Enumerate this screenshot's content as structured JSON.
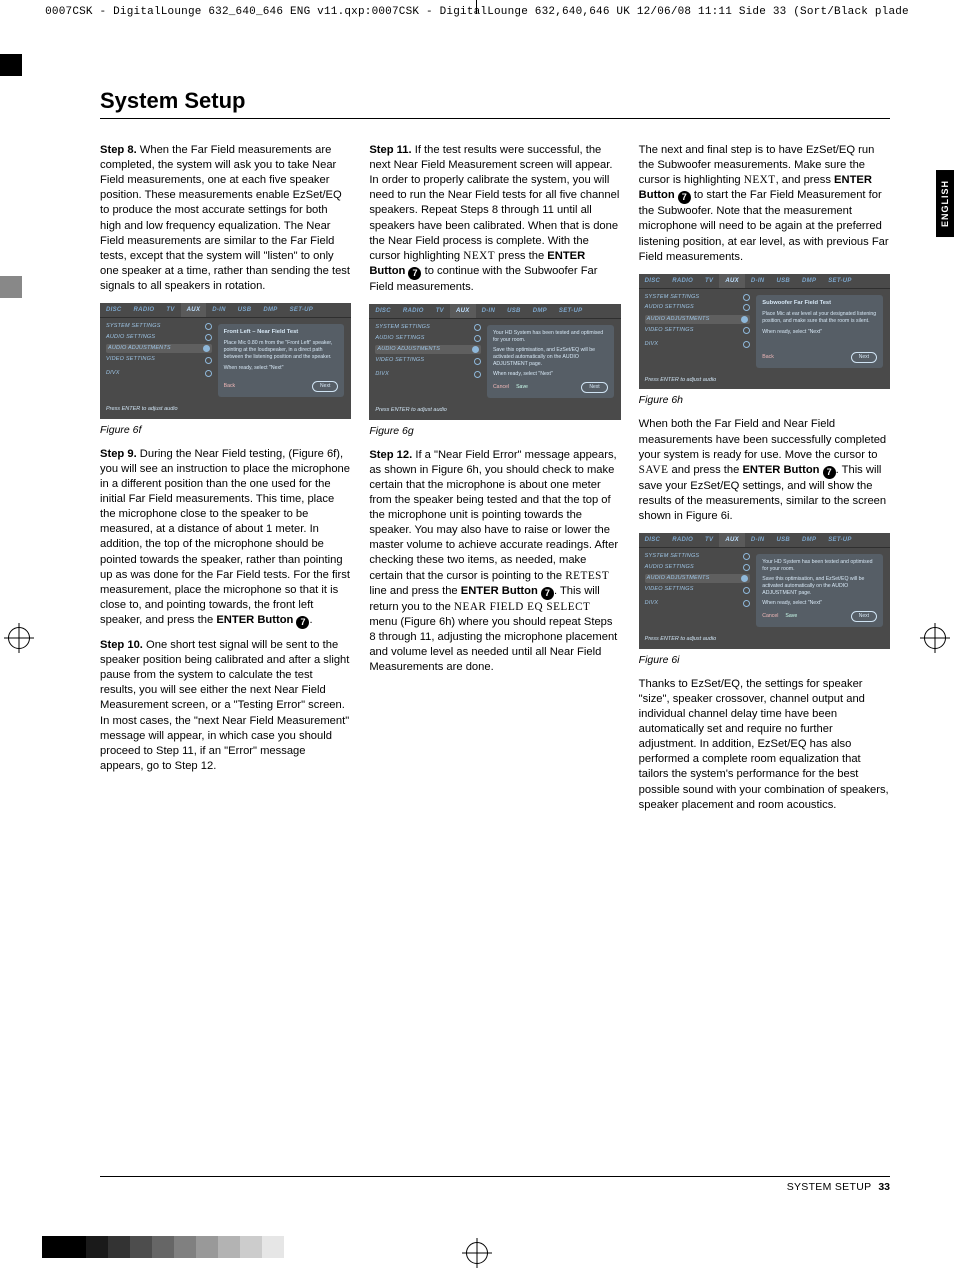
{
  "print_header": "0007CSK - DigitalLounge 632_640_646 ENG v11.qxp:0007CSK - DigitalLounge 632,640,646 UK  12/06/08  11:11  Side 33   (Sort/Black plade",
  "title": "System Setup",
  "side_tab": "ENGLISH",
  "footer": {
    "section": "SYSTEM SETUP",
    "page": "33"
  },
  "col1": {
    "p1a": "Step 8.",
    "p1b": " When the Far Field measurements are completed, the system will ask you to take Near Field measurements, one at each five speaker position. These measurements enable EzSet/EQ to produce the most accurate settings for both high and low frequency equalization. The Near Field measurements are similar to the Far Field tests, except that the system will \"listen\" to only one speaker at a time, rather than sending the test signals to all speakers in rotation.",
    "fig6f": "Figure 6f",
    "p2a": "Step 9.",
    "p2b": " During the Near Field testing, (Figure 6f), you will see an instruction to place the microphone in a different position than the one used for the initial Far Field measurements. This time, place the microphone close to the speaker to be measured, at a distance of about 1 meter. In addition, the top of the microphone should be pointed towards the speaker, rather than pointing up as was done for the Far Field tests. For the first measurement, place the microphone so that it is close to, and pointing towards, the front left speaker, and press the ",
    "p2c": "ENTER Button",
    "p2d": ".",
    "p3a": "Step 10.",
    "p3b": " One short test signal will be sent to the speaker position being calibrated and after a slight pause from the system to calculate the test results, you will see either the next Near Field Measurement screen, or a \"Testing Error\" screen. In most cases, the \"next Near Field Measurement\" message will appear, in which case you should proceed to Step 11, if an \"Error\" message appears, go to Step 12."
  },
  "col2": {
    "p1a": "Step 11.",
    "p1b": " If the test results were successful, the next Near Field Measurement screen will appear. In order to properly calibrate the system, you will need to run the Near Field tests for all five channel speakers. Repeat Steps 8 through 11 until all speakers have been calibrated. When that is done the Near Field process is complete. With the cursor highlighting ",
    "p1c": "NEXT",
    "p1d": " press the ",
    "p1e": "ENTER Button",
    "p1f": " to continue with the Subwoofer Far Field measurements.",
    "fig6g": "Figure 6g",
    "p2a": "Step 12.",
    "p2b": " If a \"Near Field Error\" message appears, as shown in Figure 6h, you should check to make certain that the microphone is about one meter from the speaker being tested and that the top of the microphone unit is pointing towards the speaker. You may also have to raise or lower the master volume to achieve accurate readings. After checking these two items, as needed, make certain that the cursor is pointing to the ",
    "p2c": "RETEST",
    "p2d": " line and press the ",
    "p2e": "ENTER Button",
    "p2f": ". This will return you to the ",
    "p2g": "NEAR FIELD EQ SELECT",
    "p2h": " menu (Figure 6h) where you should repeat Steps 8 through 11, adjusting the microphone placement and volume level as needed until all Near Field Measurements are done."
  },
  "col3": {
    "p1a": "The next and final step is to have EzSet/EQ run the Subwoofer measurements. Make sure the cursor is highlighting ",
    "p1b": "NEXT",
    "p1c": ", and press ",
    "p1d": "ENTER Button",
    "p1e": " to start the Far Field Measurement for the Subwoofer. Note that the measurement microphone will need to be again at the preferred listening position, at ear level, as with previous Far Field measurements.",
    "fig6h": "Figure 6h",
    "p2a": "When both the Far Field and Near Field measurements have been successfully completed your system is ready for use. Move the cursor to ",
    "p2b": "SAVE",
    "p2c": " and press the ",
    "p2d": "ENTER Button",
    "p2e": ". This will save your EzSet/EQ settings, and will show the results of the measurements, similar to the screen shown in Figure 6i.",
    "fig6i": "Figure 6i",
    "p3": "Thanks to EzSet/EQ, the settings for speaker \"size\", speaker crossover, channel output and individual channel delay time have been automatically set and require no further adjustment. In addition, EzSet/EQ has also performed a complete room equalization that tailors the system's performance for the best possible sound with your combination of speakers, speaker placement and room acoustics."
  },
  "osd_common": {
    "tabs": [
      "DISC",
      "RADIO",
      "TV",
      "AUX",
      "D-IN",
      "USB",
      "DMP",
      "SET-UP"
    ],
    "menu": [
      "SYSTEM SETTINGS",
      "AUDIO SETTINGS",
      "AUDIO ADJUSTMENTS",
      "VIDEO SETTINGS",
      "DIVX"
    ],
    "footer": "Press ENTER to adjust audio"
  },
  "osd6f": {
    "title": "Front Left – Near Field Test",
    "body1": "Place Mic 0.80 m from the \"Front Left\" speaker, pointing at the loudspeaker, in a direct path between the listening position and the speaker.",
    "body2": "When ready, select \"Next\"",
    "back": "Back",
    "next": "Next"
  },
  "osd6g": {
    "body1": "Your HD System has been tested and optimised for your room.",
    "body2": "Save this optimisation, and EzSet/EQ will be activated automatically on the AUDIO ADJUSTMENT page.",
    "body3": "When ready, select \"Next\"",
    "cancel": "Cancel",
    "save": "Save",
    "next": "Next"
  },
  "osd6h": {
    "title": "Subwoofer Far Field Test",
    "body1": "Place Mic at ear level at your designated listening position, and make sure that the room is silent.",
    "body2": "When ready, select \"Next\"",
    "back": "Back",
    "next": "Next"
  },
  "osd6i": {
    "body1": "Your HD System has been tested and optimised for your room.",
    "body2": "Save this optimisation, and EzSet/EQ will be activated automatically on the AUDIO ADJUSTMENT page.",
    "body3": "When ready, select \"Next\"",
    "cancel": "Cancel",
    "save": "Save",
    "next": "Next"
  },
  "circled7": "7"
}
